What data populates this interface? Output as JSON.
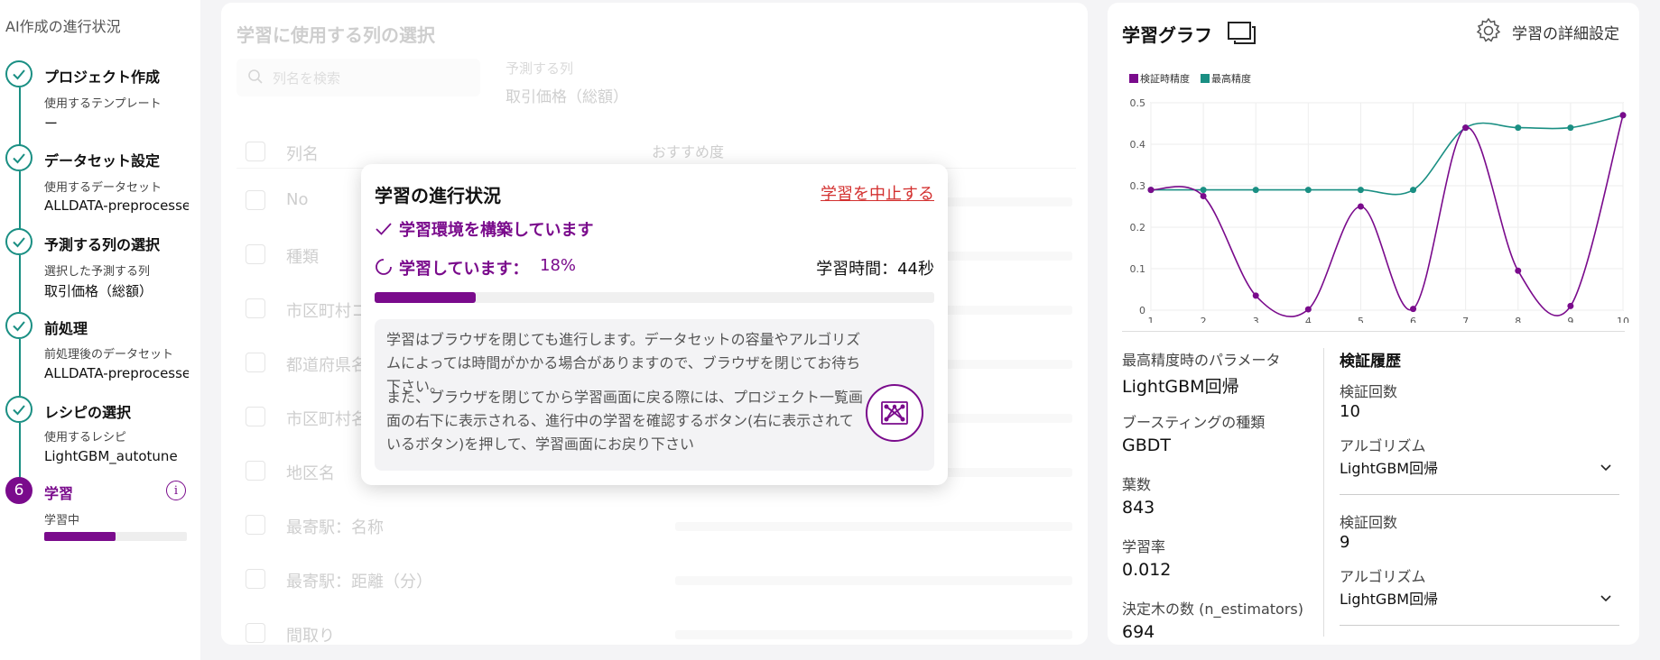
{
  "sidebar": {
    "title": "AI作成の進行状況",
    "steps": [
      {
        "title": "プロジェクト作成",
        "sub": "使用するテンプレート",
        "value": "ー"
      },
      {
        "title": "データセット設定",
        "sub": "使用するデータセット",
        "value": "ALLDATA-preprocessed"
      },
      {
        "title": "予測する列の選択",
        "sub": "選択した予測する列",
        "value": "取引価格（総額）"
      },
      {
        "title": "前処理",
        "sub": "前処理後のデータセット",
        "value": "ALLDATA-preprocessed"
      },
      {
        "title": "レシピの選択",
        "sub": "使用するレシピ",
        "value": "LightGBM_autotune"
      },
      {
        "number": "6",
        "title": "学習",
        "sub": "学習中",
        "info": "i"
      }
    ],
    "progress": 0.5
  },
  "columns_panel": {
    "title": "学習に使用する列の選択",
    "search_placeholder": "列名を検索",
    "predict_label": "予測する列",
    "predict_value": "取引価格（総額）",
    "header_name": "列名",
    "header_rec": "おすすめ度",
    "rows": [
      "No",
      "種類",
      "市区町村コード",
      "都道府県名",
      "市区町村名",
      "地区名",
      "最寄駅：名称",
      "最寄駅：距離（分）",
      "間取り"
    ]
  },
  "modal": {
    "title": "学習の進行状況",
    "cancel": "学習を中止する",
    "step1": "学習環境を構築しています",
    "step2": "学習しています：",
    "percent": "18%",
    "progress": 0.18,
    "time": "学習時間：44秒",
    "note1": "学習はブラウザを閉じても進行します。データセットの容量やアルゴリズムによっては時間がかかる場合がありますので、ブラウザを閉じてお待ち下さい。",
    "note2": "また、ブラウザを閉じてから学習画面に戻る際には、プロジェクト一覧画面の右下に表示される、進行中の学習を確認するボタン(右に表示されているボタン)を押して、学習画面にお戻り下さい"
  },
  "graph_panel": {
    "title": "学習グラフ",
    "settings": "学習の詳細設定",
    "params": [
      {
        "label": "最高精度時のパラメータ",
        "value": "LightGBM回帰"
      },
      {
        "label": "ブースティングの種類",
        "value": "GBDT"
      },
      {
        "label": "葉数",
        "value": "843"
      },
      {
        "label": "学習率",
        "value": "0.012"
      },
      {
        "label": "決定木の数 (n_estimators)",
        "value": "694"
      }
    ],
    "history": {
      "title": "検証履歴",
      "count_label": "検証回数",
      "alg_label": "アルゴリズム",
      "entries": [
        {
          "count": "10",
          "alg": "LightGBM回帰"
        },
        {
          "count": "9",
          "alg": "LightGBM回帰"
        }
      ]
    }
  },
  "colors": {
    "accent": "#7a0b8c",
    "teal": "#1a8f83",
    "danger": "#d3302f"
  },
  "chart_data": {
    "type": "line",
    "x": [
      1,
      2,
      3,
      4,
      5,
      6,
      7,
      8,
      9,
      10
    ],
    "series": [
      {
        "name": "検証時精度",
        "color": "#7a0b8c",
        "values": [
          0.29,
          0.275,
          0.035,
          0.002,
          0.25,
          0.003,
          0.44,
          0.095,
          0.01,
          0.47
        ]
      },
      {
        "name": "最高精度",
        "color": "#1a8f83",
        "values": [
          0.29,
          0.29,
          0.29,
          0.29,
          0.29,
          0.29,
          0.44,
          0.44,
          0.44,
          0.47
        ]
      }
    ],
    "xlim": [
      1,
      10
    ],
    "ylim": [
      0,
      0.5
    ],
    "yticks": [
      "0",
      "0.1",
      "0.2",
      "0.3",
      "0.4",
      "0.5"
    ],
    "xticks": [
      "1",
      "2",
      "3",
      "4",
      "5",
      "6",
      "7",
      "8",
      "9",
      "10"
    ],
    "grid": true,
    "legend": "top-left"
  }
}
